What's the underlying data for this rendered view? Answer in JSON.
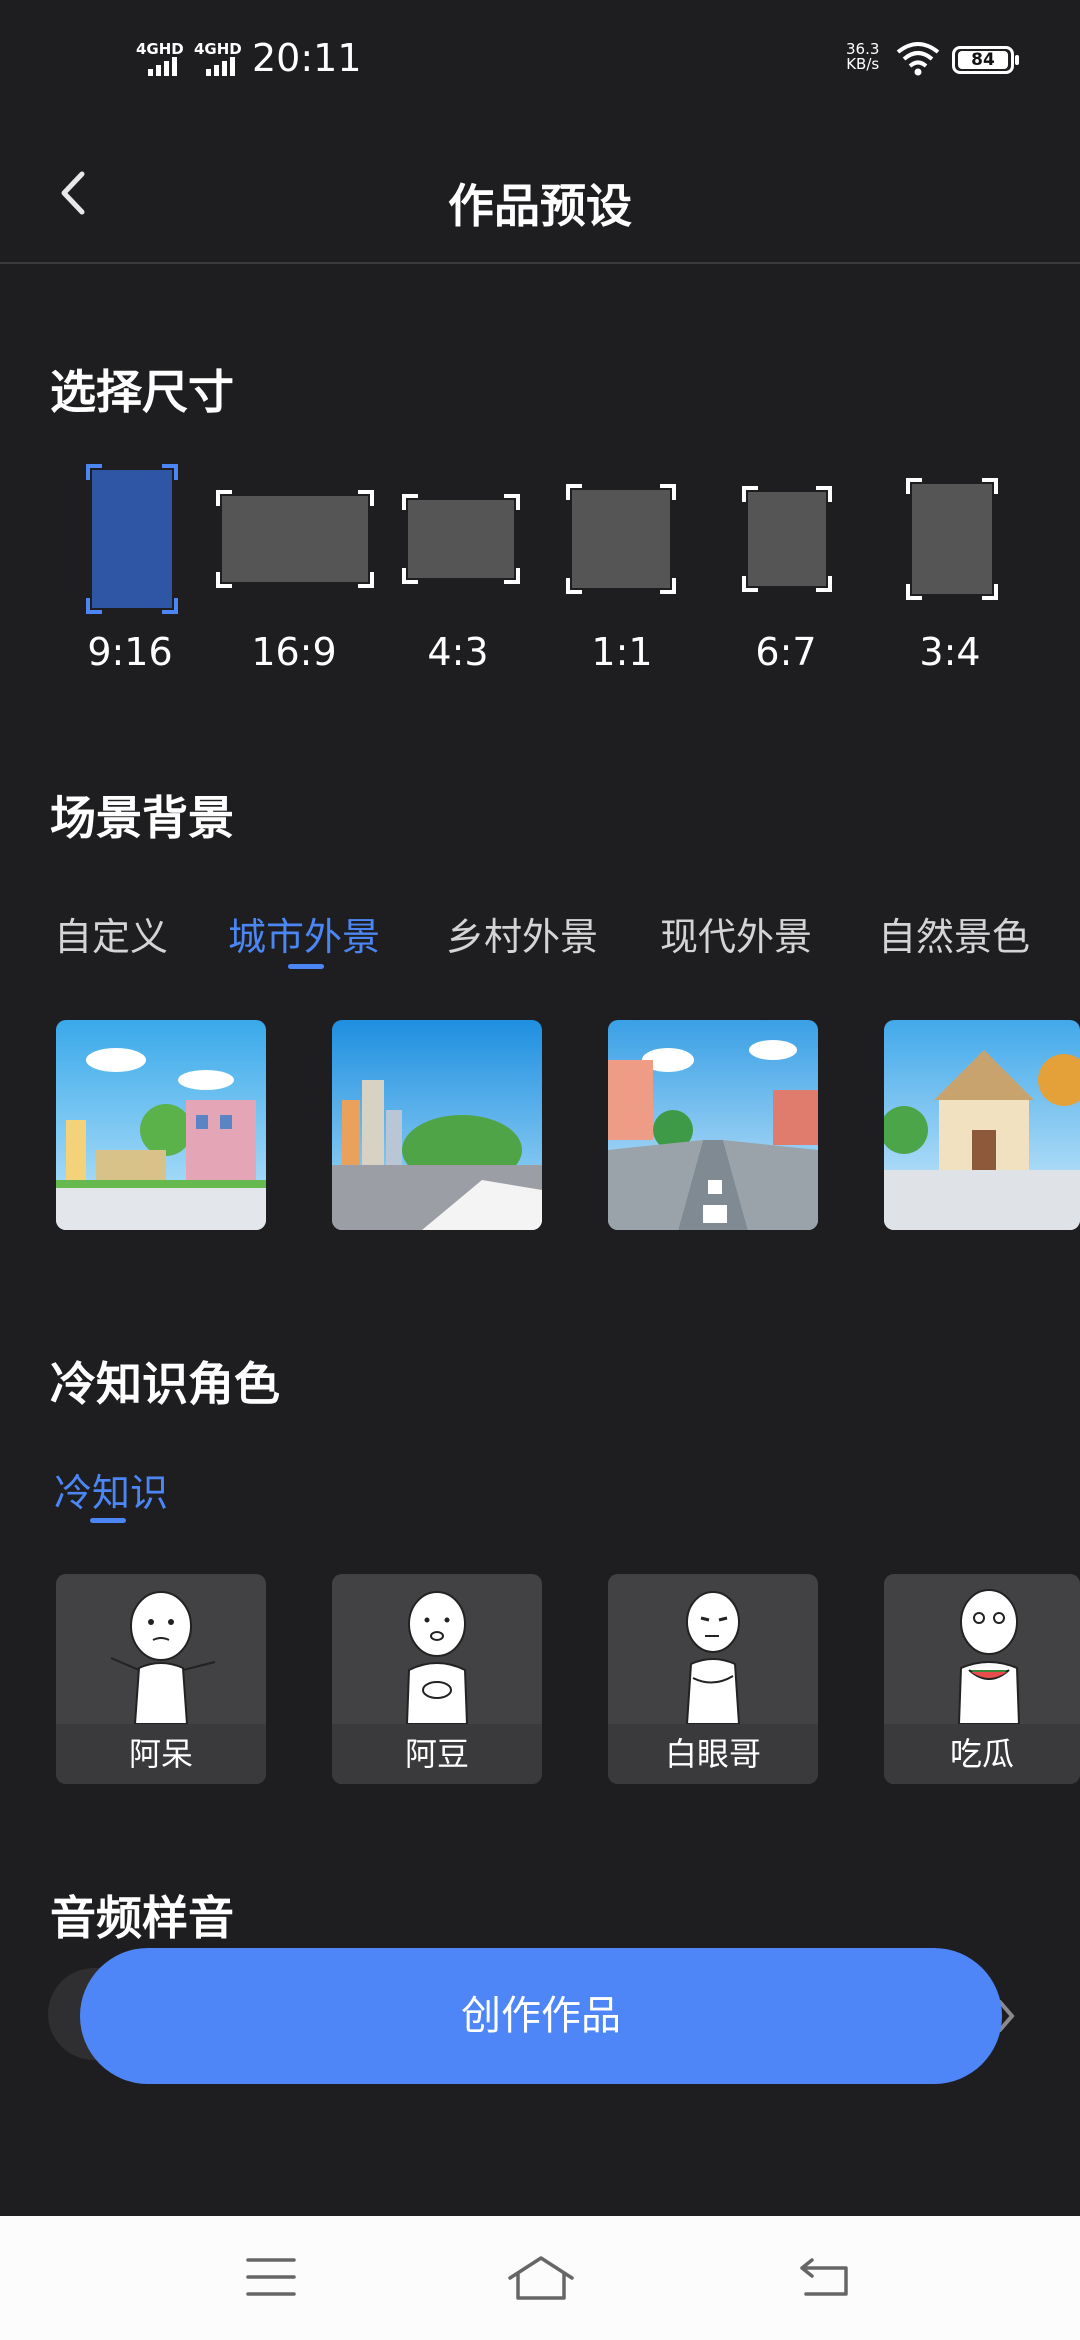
{
  "status_bar": {
    "network_1": "4GHD",
    "network_2": "4GHD",
    "time": "20:11",
    "speed_value": "36.3",
    "speed_unit": "KB/s",
    "battery": "84"
  },
  "header": {
    "title": "作品预设"
  },
  "size_section": {
    "title": "选择尺寸",
    "options": [
      {
        "label": "9:16",
        "selected": true
      },
      {
        "label": "16:9",
        "selected": false
      },
      {
        "label": "4:3",
        "selected": false
      },
      {
        "label": "1:1",
        "selected": false
      },
      {
        "label": "6:7",
        "selected": false
      },
      {
        "label": "3:4",
        "selected": false
      }
    ]
  },
  "scene_section": {
    "title": "场景背景",
    "tabs": [
      "自定义",
      "城市外景",
      "乡村外景",
      "现代外景",
      "自然景色"
    ],
    "active_tab": "城市外景"
  },
  "character_section": {
    "title": "冷知识角色",
    "tabs": [
      "冷知识"
    ],
    "characters": [
      "阿呆",
      "阿豆",
      "白眼哥",
      "吃瓜"
    ]
  },
  "audio_section": {
    "title": "音频样音"
  },
  "create_button": {
    "label": "创作作品"
  },
  "colors": {
    "background": "#1e1e20",
    "accent": "#4e86f8",
    "selected_size": "#2e56a5",
    "tile": "#555556"
  }
}
